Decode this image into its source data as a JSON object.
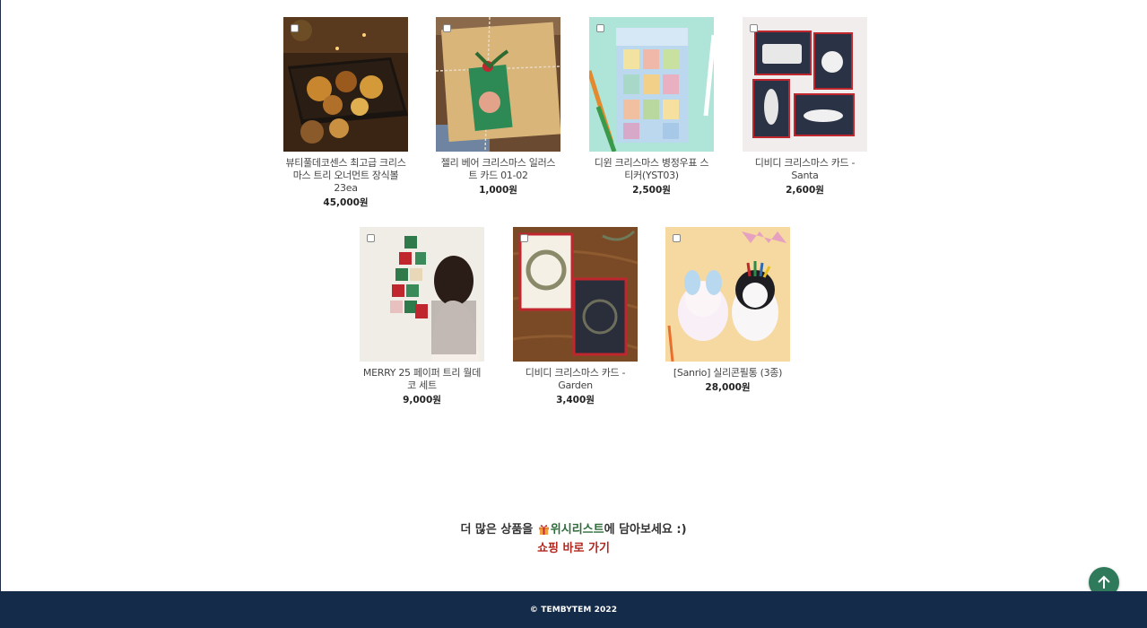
{
  "products": [
    {
      "name": "뷰티풀데코센스 최고급 크리스마스 트리 오너먼트 장식볼 23ea",
      "price": "45,000원",
      "image": "gold-ornaments-box"
    },
    {
      "name": "젤리 베어 크리스마스 일러스트 카드 01-02",
      "price": "1,000원",
      "image": "kraft-gift-card"
    },
    {
      "name": "디윈 크리스마스 병정우표 스티커(YST03)",
      "price": "2,500원",
      "image": "stamp-sticker-sheet"
    },
    {
      "name": "디비디 크리스마스 카드 - Santa",
      "price": "2,600원",
      "image": "santa-cards"
    },
    {
      "name": "MERRY 25 페이퍼 트리 월데코 세트",
      "price": "9,000원",
      "image": "paper-tree-wall"
    },
    {
      "name": "디비디 크리스마스 카드 - Garden",
      "price": "3,400원",
      "image": "garden-cards"
    },
    {
      "name": "[Sanrio] 실리콘필통 (3종)",
      "price": "28,000원",
      "image": "sanrio-pencil-case"
    }
  ],
  "promo": {
    "text_before": "더 많은 상품을 ",
    "wishlist": "위시리스트",
    "text_after": "에 담아보세요 :)",
    "link": "쇼핑 바로 가기"
  },
  "footer": {
    "copyright": "© TEMBYTEM 2022"
  },
  "colors": {
    "footer_bg": "#152b4a",
    "link": "#b3261e",
    "top_button": "#2f7a5a"
  },
  "icons": {
    "top_button": "arrow-up-icon",
    "gift": "gift-icon"
  }
}
